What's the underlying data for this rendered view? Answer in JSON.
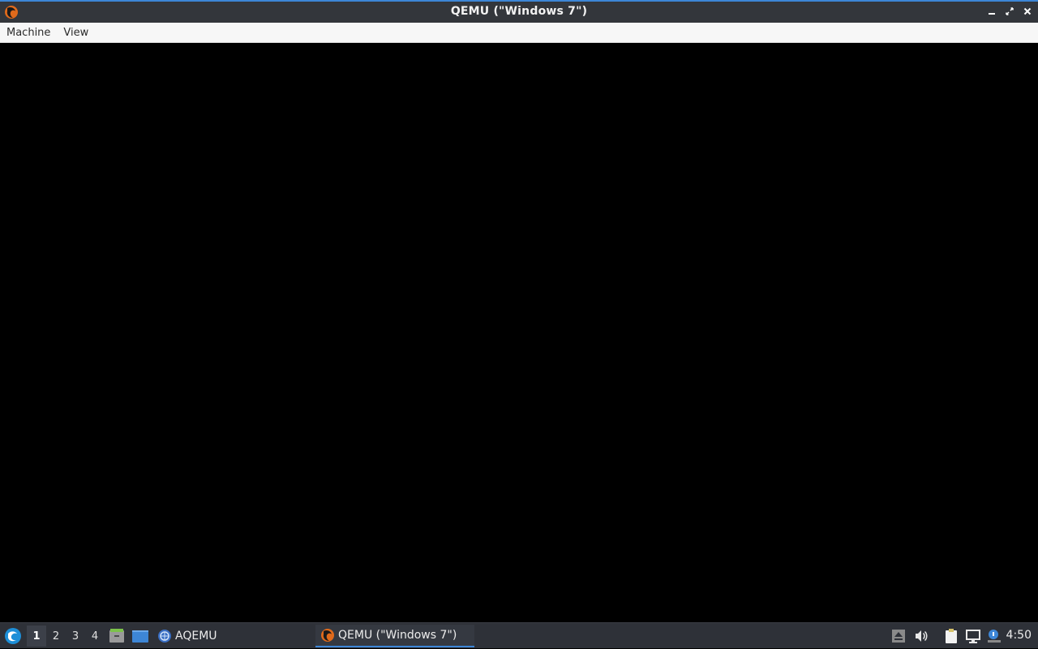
{
  "window": {
    "title": "QEMU (\"Windows 7\")"
  },
  "menubar": {
    "items": [
      "Machine",
      "View"
    ]
  },
  "taskbar": {
    "desktops": [
      "1",
      "2",
      "3",
      "4"
    ],
    "active_desktop": "1",
    "tasks": [
      {
        "label": "AQEMU",
        "icon": "aqemu-icon"
      },
      {
        "label": "QEMU (\"Windows 7\")",
        "icon": "qemu-icon",
        "active": true
      }
    ],
    "clock": "4:50"
  },
  "colors": {
    "accent": "#3d86d6",
    "titlebar": "#33363b",
    "taskbar": "#2e3138",
    "menubar": "#f7f7f7",
    "screen": "#000000"
  }
}
